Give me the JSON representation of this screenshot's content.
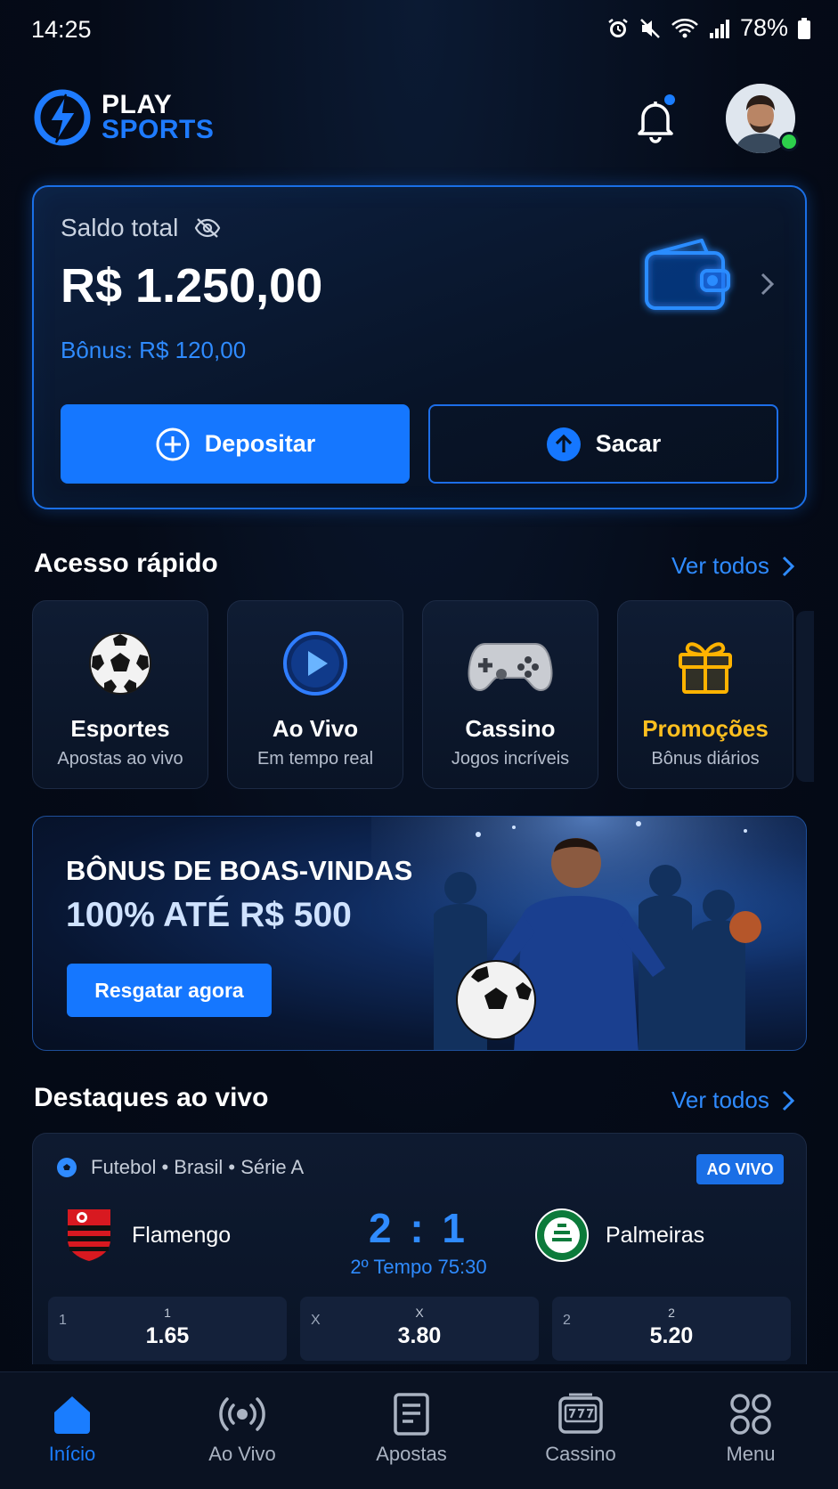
{
  "status_bar": {
    "time": "14:25",
    "battery": "78%"
  },
  "brand": {
    "line1": "PLAY",
    "line2": "SPORTS"
  },
  "balance": {
    "label": "Saldo total",
    "value": "R$ 1.250,00",
    "bonus": "Bônus: R$ 120,00",
    "deposit_label": "Depositar",
    "withdraw_label": "Sacar"
  },
  "quick_access": {
    "title": "Acesso rápido",
    "see_all": "Ver todos",
    "items": [
      {
        "title": "Esportes",
        "subtitle": "Apostas ao vivo",
        "icon": "soccer-ball-icon"
      },
      {
        "title": "Ao Vivo",
        "subtitle": "Em tempo real",
        "icon": "play-icon"
      },
      {
        "title": "Cassino",
        "subtitle": "Jogos incríveis",
        "icon": "gamepad-icon"
      },
      {
        "title": "Promoções",
        "subtitle": "Bônus diários",
        "icon": "gift-icon"
      }
    ]
  },
  "banner": {
    "line1": "BÔNUS DE BOAS-VINDAS",
    "line2": "100% ATÉ R$ 500",
    "button": "Resgatar agora"
  },
  "live_highlights": {
    "title": "Destaques ao vivo",
    "see_all": "Ver todos",
    "match": {
      "league": "Futebol • Brasil • Série A",
      "badge": "AO VIVO",
      "home": "Flamengo",
      "away": "Palmeiras",
      "score": "2 : 1",
      "time": "2º Tempo 75:30",
      "odds": [
        {
          "side": "1",
          "label": "1",
          "value": "1.65"
        },
        {
          "side": "X",
          "label": "X",
          "value": "3.80"
        },
        {
          "side": "2",
          "label": "2",
          "value": "5.20"
        }
      ]
    }
  },
  "bottom_nav": {
    "items": [
      {
        "label": "Início",
        "icon": "home-icon",
        "active": true
      },
      {
        "label": "Ao Vivo",
        "icon": "broadcast-icon"
      },
      {
        "label": "Apostas",
        "icon": "ticket-icon"
      },
      {
        "label": "Cassino",
        "icon": "slot-machine-icon"
      },
      {
        "label": "Menu",
        "icon": "grid-icon"
      }
    ]
  },
  "colors": {
    "accent": "#1577ff",
    "link": "#2f8bff",
    "gold": "#ffbf1f",
    "background": "#050b18",
    "online": "#2dd04b"
  }
}
